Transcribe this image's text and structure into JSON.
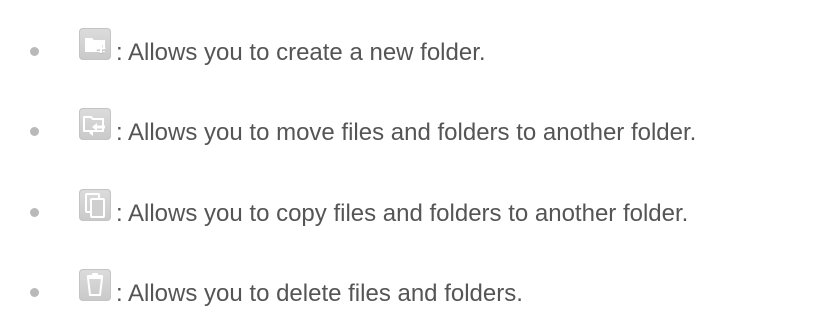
{
  "items": [
    {
      "icon": "new-folder-icon",
      "text": ": Allows you to create a new folder."
    },
    {
      "icon": "move-folder-icon",
      "text": ": Allows you to move files and folders to another folder."
    },
    {
      "icon": "copy-icon",
      "text": ": Allows you to copy files and folders to another folder."
    },
    {
      "icon": "trash-icon",
      "text": ": Allows you to delete files and folders."
    }
  ],
  "colors": {
    "text": "#555555",
    "bullet": "#b9b9b9",
    "icon_tile": "#d4d4d4",
    "icon_glyph": "#ffffff"
  }
}
